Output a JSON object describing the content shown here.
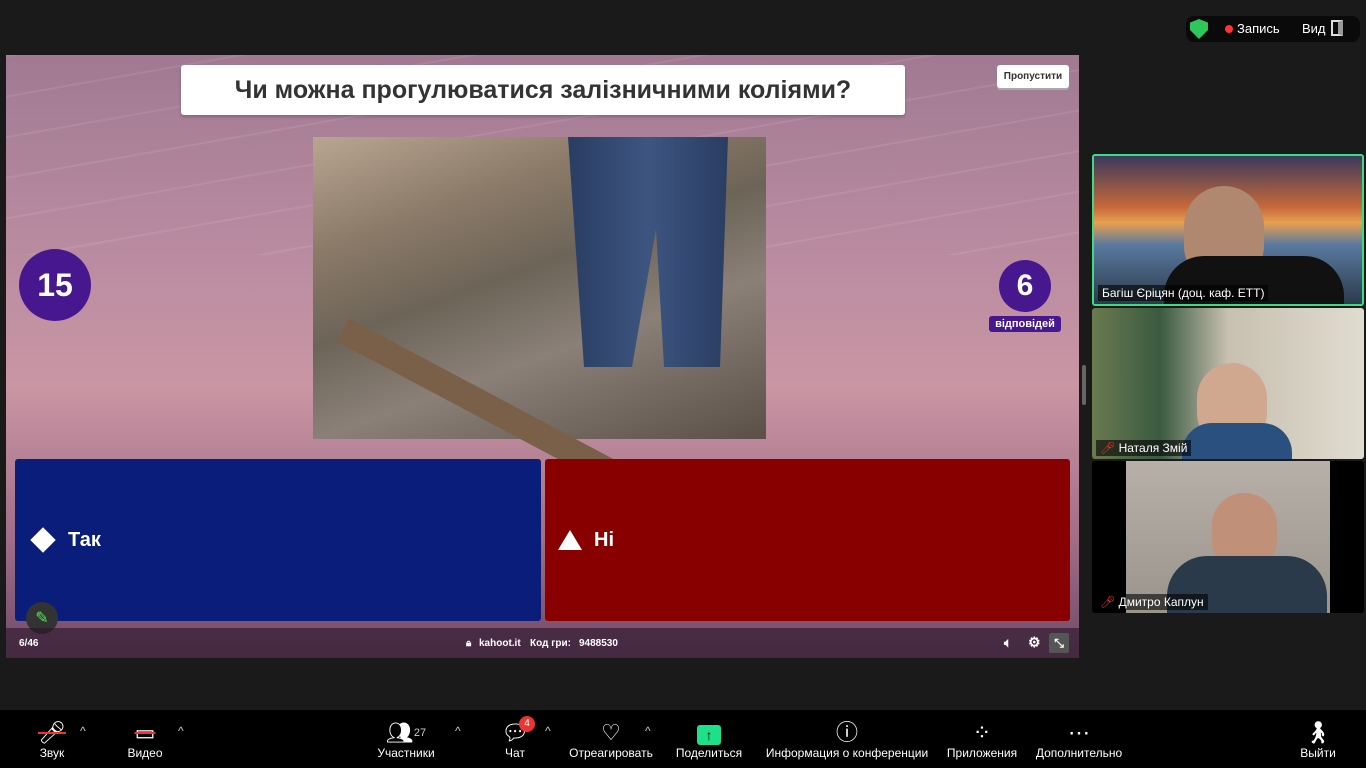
{
  "top_bar": {
    "recording_label": "Запись",
    "view_label": "Вид"
  },
  "kahoot": {
    "question": "Чи можна прогулюватися залізничними коліями?",
    "skip_label": "Пропустити",
    "timer": "15",
    "answers_count": "6",
    "answers_label": "відповідей",
    "answers": [
      {
        "label": "Так",
        "shape": "diamond",
        "color": "#0a1d7a"
      },
      {
        "label": "Ні",
        "shape": "triangle",
        "color": "#890000"
      }
    ],
    "progress": "6/46",
    "site": "kahoot.it",
    "game_code_label": "Код гри:",
    "game_code": "9488530"
  },
  "participants": [
    {
      "name": "Багіш Єріцян (доц. каф. ЕТТ)",
      "muted": false
    },
    {
      "name": "Наталя Змій",
      "muted": true
    },
    {
      "name": "Дмитро Каплун",
      "muted": true
    }
  ],
  "toolbar": {
    "audio": "Звук",
    "video": "Видео",
    "participants": "Участники",
    "participants_count": "27",
    "chat": "Чат",
    "chat_badge": "4",
    "react": "Отреагировать",
    "share": "Поделиться",
    "info": "Информация о конференции",
    "apps": "Приложения",
    "more": "Дополнительно",
    "leave": "Выйти"
  }
}
